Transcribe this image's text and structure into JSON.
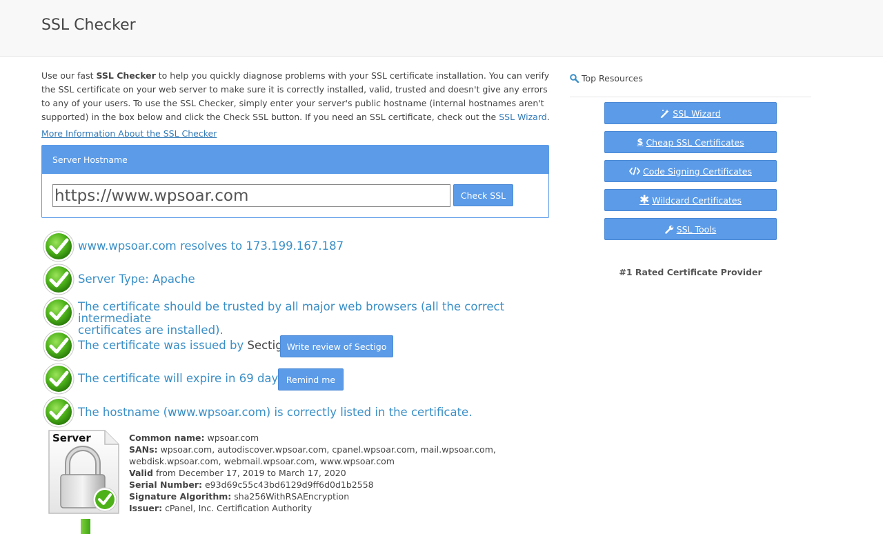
{
  "header": {
    "title": "SSL Checker"
  },
  "intro": {
    "text_before": "Use our fast ",
    "bold": "SSL Checker",
    "text_after": " to help you quickly diagnose problems with your SSL certificate installation. You can verify the SSL certificate on your web server to make sure it is correctly installed, valid, trusted and doesn't give any errors to any of your users. To use the SSL Checker, simply enter your server's public hostname (internal hostnames aren't supported) in the box below and click the Check SSL button. If you need an SSL certificate, check out the ",
    "wizard_link": "SSL Wizard",
    "period": ".",
    "more_link": "More Information About the SSL Checker"
  },
  "form": {
    "panel_title": "Server Hostname",
    "hostname_value": "https://www.wpsoar.com",
    "check_label": "Check SSL"
  },
  "results": {
    "r1": "www.wpsoar.com resolves to 173.199.167.187",
    "r2": "Server Type: Apache",
    "r3a": "The certificate should be trusted by all major web browsers (all the correct intermediate",
    "r3b": "certificates are installed).",
    "r4_prefix": "The certificate was issued by ",
    "r4_issuer": "Sectigo",
    "r4_suffix": ".",
    "r4_button": "Write review of Sectigo",
    "r5": "The certificate will expire in 69 days.",
    "r5_button": "Remind me",
    "r6": "The hostname (www.wpsoar.com) is correctly listed in the certificate."
  },
  "certificate": {
    "icon_label": "Server",
    "common_name_label": "Common name:",
    "common_name": "wpsoar.com",
    "sans_label": "SANs:",
    "sans_line1": "wpsoar.com, autodiscover.wpsoar.com, cpanel.wpsoar.com, mail.wpsoar.com,",
    "sans_line2": "webdisk.wpsoar.com, webmail.wpsoar.com, www.wpsoar.com",
    "valid_label": "Valid",
    "valid_text": "from December 17, 2019 to March 17, 2020",
    "serial_label": "Serial Number:",
    "serial": "e93d69c55c43bd6129d9ff6d0d1b2558",
    "sig_label": "Signature Algorithm:",
    "sig": "sha256WithRSAEncryption",
    "issuer_label": "Issuer:",
    "issuer": "cPanel, Inc. Certification Authority"
  },
  "sidebar": {
    "title": "Top Resources",
    "buttons": [
      {
        "label": "SSL Wizard",
        "icon": "magic-wand-icon"
      },
      {
        "label": "Cheap SSL Certificates",
        "icon": "dollar-icon"
      },
      {
        "label": "Code Signing Certificates",
        "icon": "code-icon"
      },
      {
        "label": "Wildcard Certificates",
        "icon": "asterisk-icon"
      },
      {
        "label": "SSL Tools",
        "icon": "wrench-icon"
      }
    ],
    "rated": "#1 Rated Certificate Provider"
  },
  "colors": {
    "accent": "#5b9be8",
    "link": "#337ab7",
    "result_text": "#3a8fc7",
    "check_green": "#3ea512"
  }
}
